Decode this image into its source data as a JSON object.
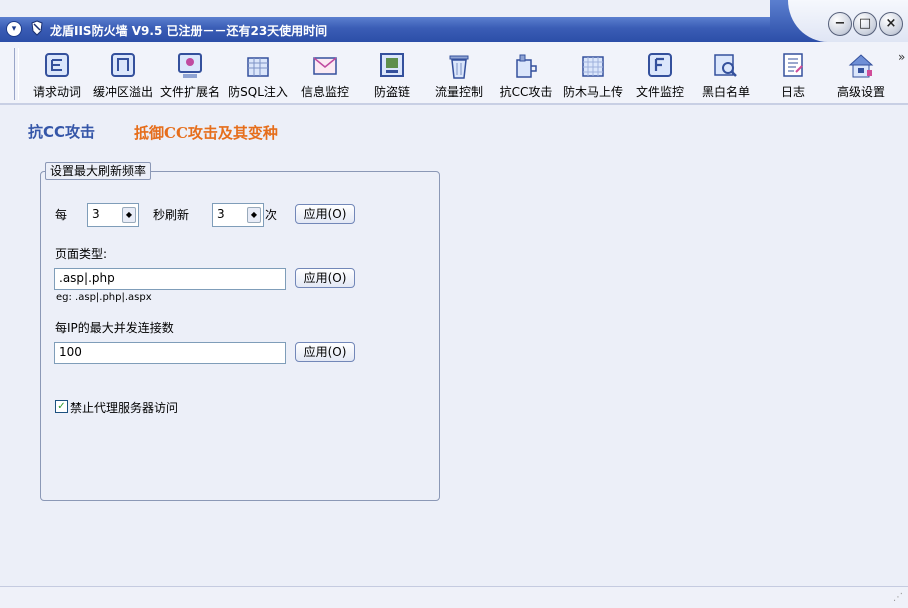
{
  "window": {
    "title": "龙盾IIS防火墙 V9.5 已注册－－还有23天使用时间"
  },
  "toolbar": {
    "items": [
      {
        "label": "请求动词",
        "icon": "request-verb-icon"
      },
      {
        "label": "缓冲区溢出",
        "icon": "buffer-overflow-icon"
      },
      {
        "label": "文件扩展名",
        "icon": "file-extension-icon"
      },
      {
        "label": "防SQL注入",
        "icon": "sql-injection-icon"
      },
      {
        "label": "信息监控",
        "icon": "envelope-icon"
      },
      {
        "label": "防盗链",
        "icon": "anti-leech-icon"
      },
      {
        "label": "流量控制",
        "icon": "trash-icon"
      },
      {
        "label": "抗CC攻击",
        "icon": "cc-attack-icon"
      },
      {
        "label": "防木马上传",
        "icon": "trojan-upload-icon"
      },
      {
        "label": "文件监控",
        "icon": "file-monitor-icon"
      },
      {
        "label": "黑白名单",
        "icon": "blackwhite-list-icon"
      },
      {
        "label": "日志",
        "icon": "log-icon"
      },
      {
        "label": "高级设置",
        "icon": "house-icon"
      }
    ],
    "overflow": "»"
  },
  "page": {
    "heading": "抗CC攻击",
    "subheading": "抵御CC攻击及其变种"
  },
  "form": {
    "legend": "设置最大刷新频率",
    "every_label": "每",
    "seconds_value": "3",
    "refresh_label": "秒刷新",
    "times_value": "3",
    "times_label": "次",
    "apply_label": "应用(O)",
    "page_type_label": "页面类型:",
    "page_type_value": ".asp|.php",
    "page_type_example": "eg: .asp|.php|.aspx",
    "max_conn_label": "每IP的最大并发连接数",
    "max_conn_value": "100",
    "proxy_label": "禁止代理服务器访问",
    "proxy_checked": true
  }
}
